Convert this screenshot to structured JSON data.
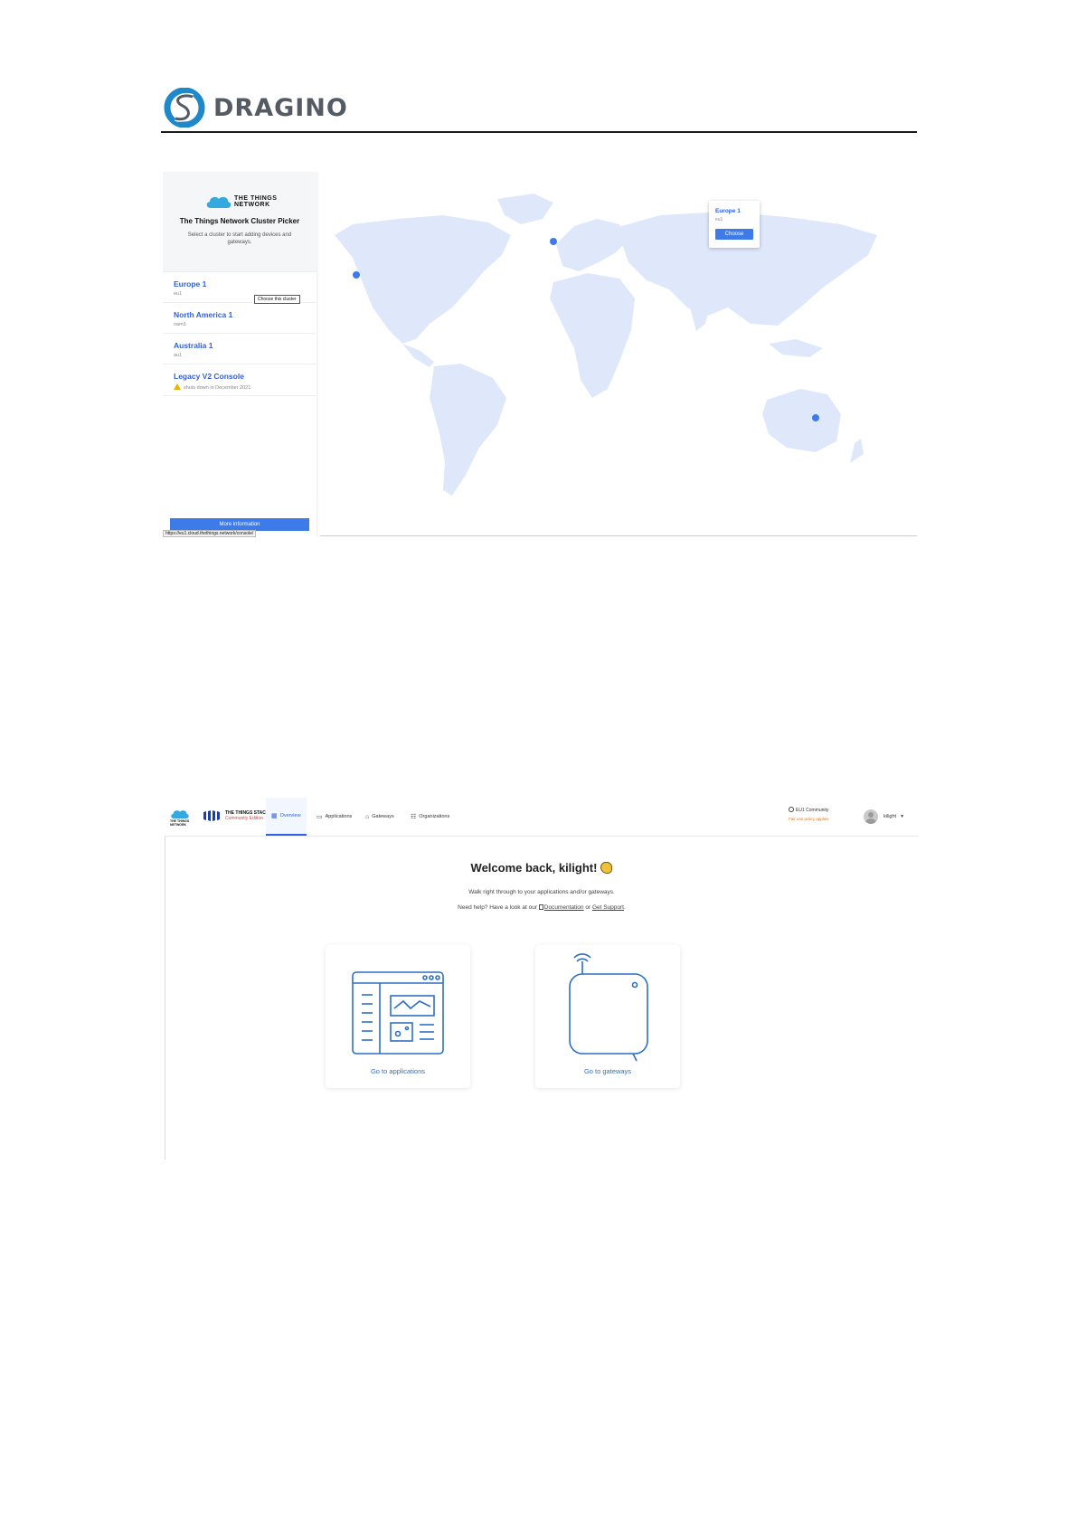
{
  "brand": {
    "name": "DRAGINO",
    "icon": "dragino-logo-icon",
    "accent": "#1e88c8"
  },
  "cluster_picker": {
    "logo_text_line1": "THE THINGS",
    "logo_text_line2": "NETWORK",
    "title": "The Things Network Cluster Picker",
    "description": "Select a cluster to start adding devices and gateways.",
    "clusters": [
      {
        "name": "Europe 1",
        "id": "eu1"
      },
      {
        "name": "North America 1",
        "id": "nam1"
      },
      {
        "name": "Australia 1",
        "id": "au1"
      },
      {
        "name": "Legacy V2 Console",
        "id": "shuts down in December 2021"
      }
    ],
    "tooltip": "Choose this cluster",
    "more_info_label": "More information",
    "status_url": "https://eu1.cloud.thethings.network/console/",
    "map_popup": {
      "name": "Europe 1",
      "id": "eu1",
      "button": "Choose"
    },
    "accent": "#3d7be8"
  },
  "console": {
    "ttn_logo_text": "THE THINGS NETWORK",
    "stack_title": "THE THINGS STACK",
    "stack_edition": "Community Edition",
    "nav": [
      {
        "label": "Overview",
        "icon": "overview-icon"
      },
      {
        "label": "Applications",
        "icon": "applications-icon"
      },
      {
        "label": "Gateways",
        "icon": "gateways-icon"
      },
      {
        "label": "Organizations",
        "icon": "organizations-icon"
      }
    ],
    "community_label": "EU1 Community",
    "community_link": "Fair use policy applies",
    "user_name": "kilight",
    "welcome": "Welcome back, kilight!",
    "walk_text": "Walk right through to your applications and/or gateways.",
    "help_prefix": "Need help? Have a look at our",
    "help_docs": "Documentation",
    "help_or": "or",
    "help_support": "Get Support",
    "help_suffix": ".",
    "cards": [
      {
        "label": "Go to applications",
        "icon": "applications-illustration-icon"
      },
      {
        "label": "Go to gateways",
        "icon": "gateway-illustration-icon"
      }
    ]
  }
}
